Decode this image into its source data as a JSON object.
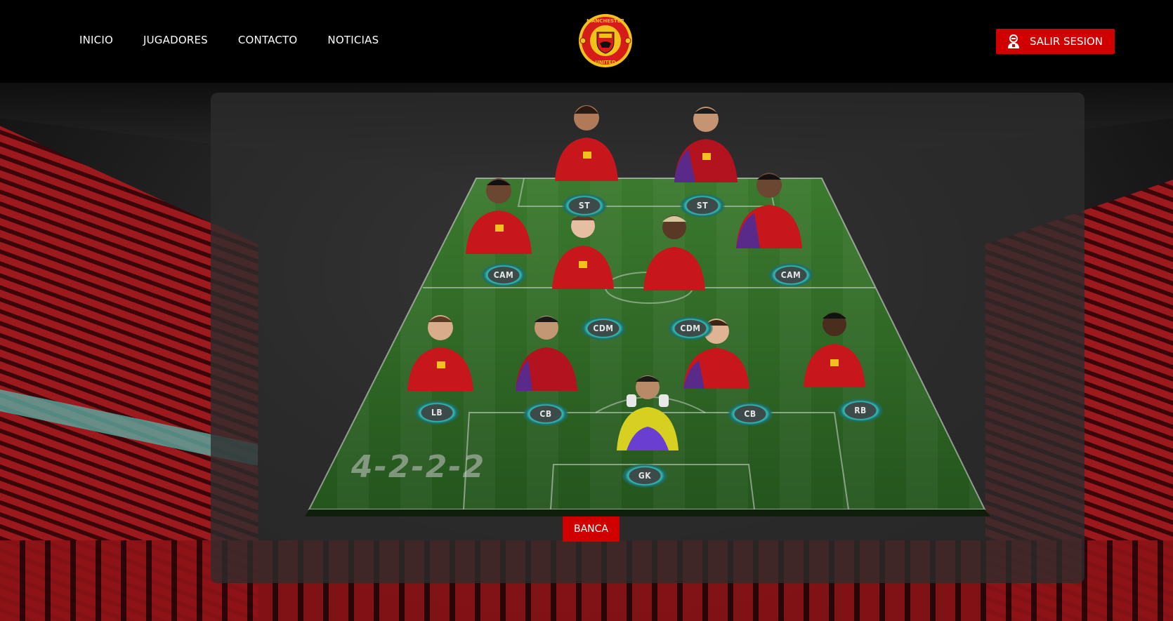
{
  "nav": {
    "items": [
      "INICIO",
      "JUGADORES",
      "CONTACTO",
      "NOTICIAS"
    ]
  },
  "logo": {
    "text_top": "MANCHESTER",
    "text_bottom": "UNITED"
  },
  "header": {
    "logout_label": "SALIR SESION",
    "logout_icon": "user-logout-icon"
  },
  "lineup": {
    "formation": "4-2-2-2",
    "bench_label": "BANCA",
    "positions": [
      "ST",
      "ST",
      "CAM",
      "CAM",
      "CDM",
      "CDM",
      "LB",
      "CB",
      "CB",
      "RB",
      "GK"
    ]
  },
  "colors": {
    "accent": "#d00000",
    "header_bg": "#000000",
    "kit_red": "#c8161d",
    "gk_kit": "#d8d020",
    "slot_glow": "#34c0b6",
    "pitch_green": "#2f6b26"
  }
}
